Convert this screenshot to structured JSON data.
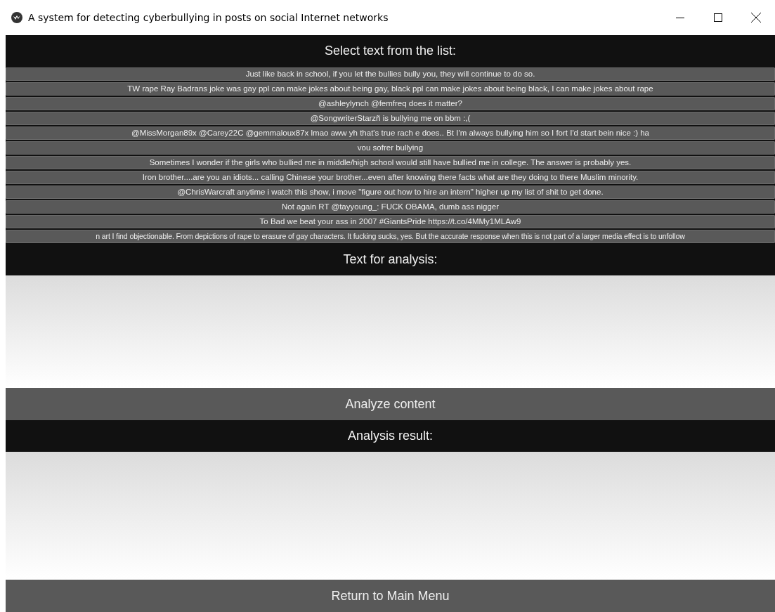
{
  "window": {
    "title": "A system for detecting cyberbullying in posts on social Internet networks"
  },
  "list_heading": "Select text from the list:",
  "posts": [
    {
      "text": "Just like back in school, if you let the bullies bully you, they will continue to do so."
    },
    {
      "text": "TW rape Ray Badrans joke was gay ppl can make jokes about being gay, black ppl can make jokes about being black, I can make jokes about rape"
    },
    {
      "text": "@ashleylynch @femfreq does it matter?"
    },
    {
      "text": "@SongwriterStarzñ is bullying me on bbm :,("
    },
    {
      "text": "@MissMorgan89x @Carey22C @gemmaloux87x lmao aww yh that's true rach e does.. Bt I'm always bullying him so I fort I'd start bein nice :) ha"
    },
    {
      "text": "vou sofrer bullying"
    },
    {
      "text": "Sometimes I wonder if the girls who bullied me in middle/high school would still have bullied me in college. The answer is probably yes."
    },
    {
      "text": "Iron brother....are you an idiots... calling Chinese your brother...even after knowing there facts what are they doing to there Muslim minority."
    },
    {
      "text": "@ChrisWarcraft anytime i watch this show, i move \"figure out how to hire an intern\" higher up my list of shit to get done."
    },
    {
      "text": "Not again RT @tayyoung_: FUCK OBAMA, dumb ass nigger"
    },
    {
      "text": "To Bad we beat your ass in 2007 #GiantsPride https://t.co/4MMy1MLAw9"
    },
    {
      "text": "n art I find objectionable. From depictions of rape to erasure of gay characters. It fucking sucks, yes. But the accurate response when this is not part of a larger media effect is to unfollow"
    }
  ],
  "input_heading": "Text for analysis:",
  "analyze_button": "Analyze content",
  "result_heading": "Analysis result:",
  "return_button": "Return to Main Menu"
}
